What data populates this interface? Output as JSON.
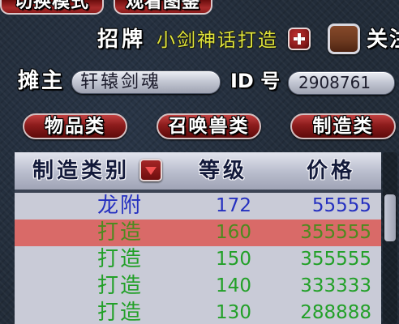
{
  "top_tabs": [
    {
      "label": "切换模式"
    },
    {
      "label": "观看图鉴"
    }
  ],
  "signboard": {
    "label": "招牌",
    "value": "小剑神话打造",
    "follow_label": "关注"
  },
  "stall_owner": {
    "label": "摊主",
    "value": "轩辕剑魂"
  },
  "stall_id": {
    "label": "ID 号",
    "value": "2908761"
  },
  "category_tabs": [
    {
      "label": "物品类"
    },
    {
      "label": "召唤兽类"
    },
    {
      "label": "制造类"
    }
  ],
  "table": {
    "headers": {
      "category": "制造类别",
      "level": "等级",
      "price": "价格"
    },
    "rows": [
      {
        "category": "龙附",
        "level": "172",
        "price": "55555",
        "text_color": "#2530c0",
        "selected": false
      },
      {
        "category": "打造",
        "level": "160",
        "price": "355555",
        "text_color": "#4d8a1f",
        "selected": true
      },
      {
        "category": "打造",
        "level": "150",
        "price": "355555",
        "text_color": "#22a028",
        "selected": false
      },
      {
        "category": "打造",
        "level": "140",
        "price": "333333",
        "text_color": "#22a028",
        "selected": false
      },
      {
        "category": "打造",
        "level": "130",
        "price": "288888",
        "text_color": "#22a028",
        "selected": false
      }
    ]
  },
  "icons": {
    "signboard_edit_button": "plus-icon",
    "category_dropdown": "triangle-down-icon"
  },
  "colors": {
    "background": "#222c39",
    "button_red": "#8c1c1c",
    "signboard_text": "#dfe43c",
    "label_text": "#ffffff",
    "field_text": "#1c1c2c",
    "header_text": "#131a3a",
    "row_background": "#c9cbd7",
    "selected_row_background": "#d96a68",
    "follow_box": "#6e3a20"
  }
}
